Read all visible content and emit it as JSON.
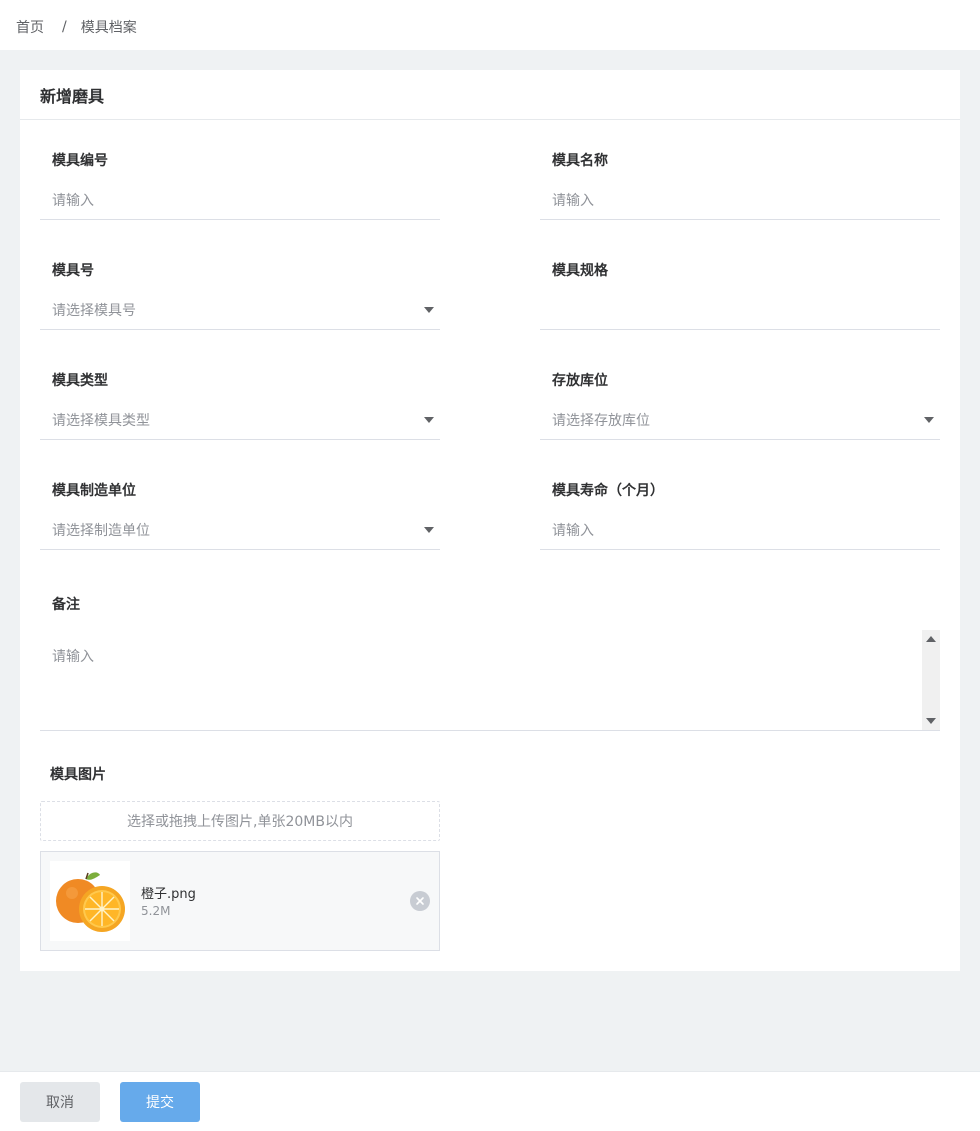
{
  "breadcrumb": {
    "home": "首页",
    "separator": "/",
    "current": "模具档案"
  },
  "form": {
    "title": "新增磨具",
    "mold_code": {
      "label": "模具编号",
      "placeholder": "请输入"
    },
    "mold_name": {
      "label": "模具名称",
      "placeholder": "请输入"
    },
    "mold_no": {
      "label": "模具号",
      "placeholder": "请选择模具号"
    },
    "mold_spec": {
      "label": "模具规格",
      "placeholder": ""
    },
    "mold_type": {
      "label": "模具类型",
      "placeholder": "请选择模具类型"
    },
    "storage_location": {
      "label": "存放库位",
      "placeholder": "请选择存放库位"
    },
    "manufacturer": {
      "label": "模具制造单位",
      "placeholder": "请选择制造单位"
    },
    "lifespan": {
      "label": "模具寿命（个月）",
      "placeholder": "请输入"
    },
    "remark": {
      "label": "备注",
      "placeholder": "请输入"
    },
    "image": {
      "label": "模具图片",
      "upload_hint": "选择或拖拽上传图片,单张20MB以内",
      "file": {
        "name": "橙子.png",
        "size": "5.2M"
      }
    }
  },
  "footer": {
    "cancel_label": "取消",
    "submit_label": "提交"
  },
  "colors": {
    "accent": "#66aaeb",
    "page_bg": "#eff2f3"
  }
}
